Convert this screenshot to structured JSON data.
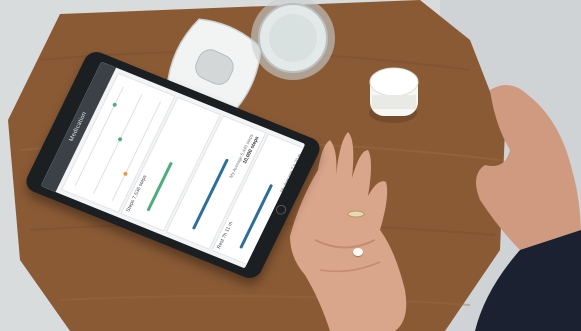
{
  "colors": {
    "background_wall": "#d9dcdd",
    "table_wood": "#8a5a35",
    "table_wood_light": "#a8744a",
    "skin": "#d9a58b",
    "sleeve": "#1b2130",
    "tablet_frame": "#1c1f22",
    "app_header": "#3b4147",
    "accent_green": "#4caf7a",
    "accent_blue": "#2d6f9c",
    "accent_orange": "#f29a3a"
  },
  "tablet_app": {
    "title": "Medication",
    "panels": [
      {
        "label": "Steps 7,536 steps",
        "value": "",
        "sub": "",
        "bar_color": "#4caf7a",
        "fill": 0.55
      },
      {
        "label": "Rest",
        "value": "10,000 steps",
        "sub": "My Average 5,440 steps",
        "bar_color": "#2d6f9c",
        "fill": 0.8
      },
      {
        "label": "Rest 7h 11 m",
        "value": "8h 30 m",
        "sub": "My Average 7 h 20 m",
        "bar_color": "#2d6f9c",
        "fill": 0.72
      }
    ]
  }
}
